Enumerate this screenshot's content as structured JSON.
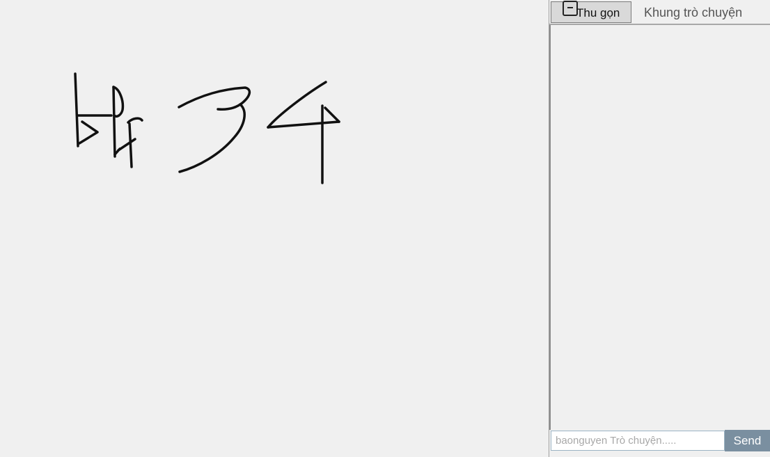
{
  "drawing_canvas": {
    "stroke_color": "#111111",
    "background": "#f0f0f0"
  },
  "chat": {
    "collapse_label": "Thu gọn",
    "title": "Khung trò chuyện",
    "input_value": "",
    "input_placeholder": "baonguyen Trò chuyện.....",
    "send_label": "Send",
    "send_color": "#7a8fa0",
    "messages": []
  }
}
